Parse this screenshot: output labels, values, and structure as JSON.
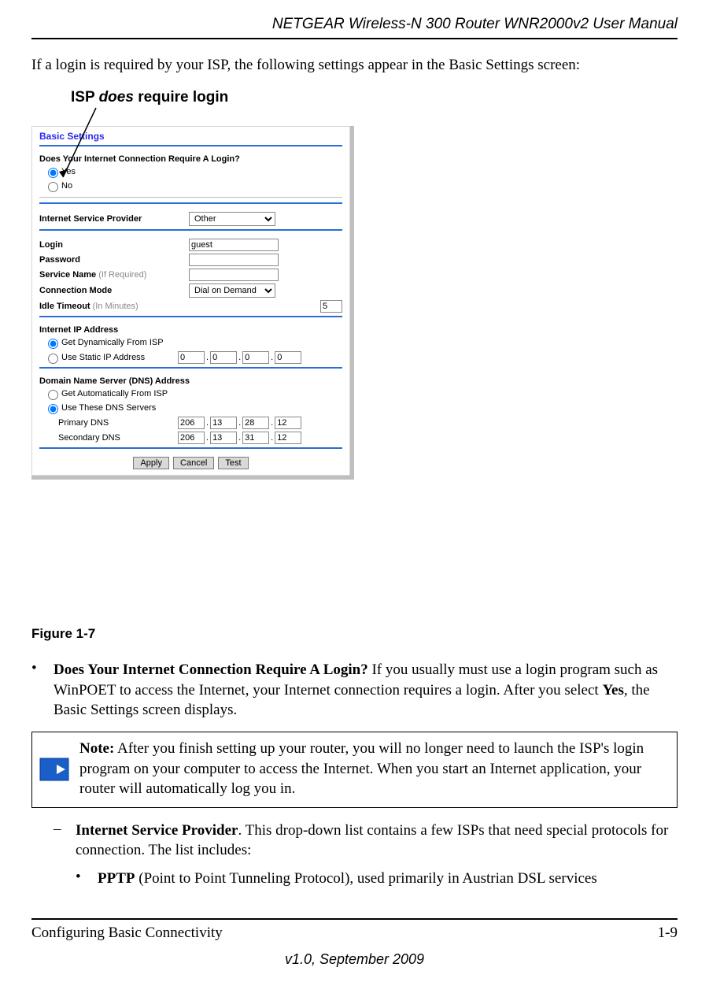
{
  "header": {
    "title": "NETGEAR Wireless-N 300 Router WNR2000v2 User Manual"
  },
  "intro": "If a login is required by your ISP, the following settings appear in the Basic Settings screen:",
  "callout": {
    "pre": "ISP ",
    "em": "does",
    "post": " require login"
  },
  "scr": {
    "title": "Basic Settings",
    "q": "Does Your Internet Connection Require A Login?",
    "yes": "Yes",
    "no": "No",
    "isp_label": "Internet Service Provider",
    "isp_value": "Other",
    "login_label": "Login",
    "login_value": "guest",
    "password_label": "Password",
    "service_label": "Service Name ",
    "service_hint": "(If Required)",
    "conn_label": "Connection Mode",
    "conn_value": "Dial on Demand",
    "idle_label": "Idle Timeout ",
    "idle_hint": "(In Minutes)",
    "idle_value": "5",
    "ip_title": "Internet IP Address",
    "ip_dyn": "Get Dynamically From ISP",
    "ip_static": "Use Static IP Address",
    "ip": [
      "0",
      "0",
      "0",
      "0"
    ],
    "dns_title": "Domain Name Server (DNS) Address",
    "dns_auto": "Get Automatically From ISP",
    "dns_use": "Use These DNS Servers",
    "pdns_label": "Primary DNS",
    "pdns": [
      "206",
      "13",
      "28",
      "12"
    ],
    "sdns_label": "Secondary DNS",
    "sdns": [
      "206",
      "13",
      "31",
      "12"
    ],
    "apply": "Apply",
    "cancel": "Cancel",
    "test": "Test"
  },
  "figcap": "Figure 1-7",
  "b1": {
    "marker": "•",
    "bold": "Does Your Internet Connection Require A Login?",
    "text": " If you usually must use a login program such as WinPOET to access the Internet, your Internet connection requires a login. After you select ",
    "bold2": "Yes",
    "text2": ", the Basic Settings screen displays."
  },
  "note": {
    "bold": "Note:",
    "text": " After you finish setting up your router, you will no longer need to launch the ISP's login program on your computer to access the Internet. When you start an Internet application, your router will automatically log you in."
  },
  "d1": {
    "marker": "–",
    "bold": "Internet Service Provider",
    "text": ". This drop-down list contains a few ISPs that need special protocols for connection. The list includes:"
  },
  "ib1": {
    "marker": "•",
    "bold": "PPTP",
    "text": " (Point to Point Tunneling Protocol), used primarily in Austrian DSL services"
  },
  "footer": {
    "left": "Configuring Basic Connectivity",
    "right": "1-9",
    "ver": "v1.0, September 2009"
  }
}
